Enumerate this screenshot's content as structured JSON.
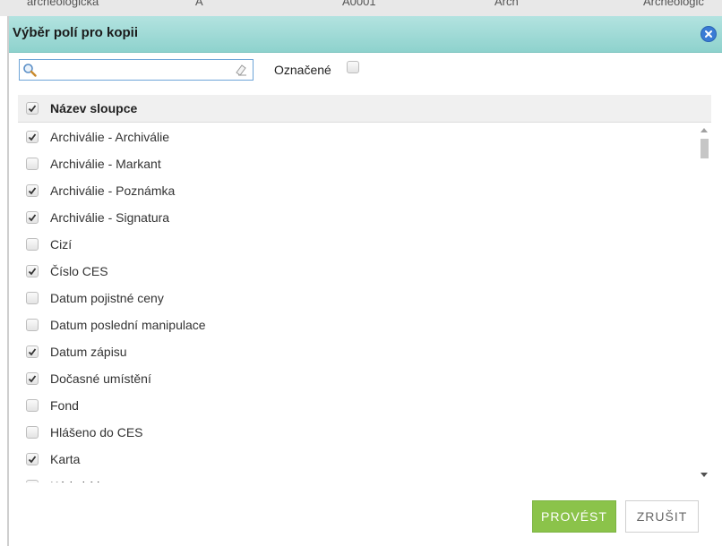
{
  "background_row": {
    "cells": [
      "archeologická",
      "A",
      "A0001",
      "Arch",
      "Archeologic"
    ]
  },
  "dialog": {
    "title": "Výběr polí pro kopii",
    "search": {
      "value": "",
      "placeholder": ""
    },
    "marked_label": "Označené",
    "marked_checked": false,
    "header": {
      "label": "Název sloupce",
      "checked": true
    },
    "items": [
      {
        "label": "Archiválie - Archiválie",
        "checked": true
      },
      {
        "label": "Archiválie - Markant",
        "checked": false
      },
      {
        "label": "Archiválie - Poznámka",
        "checked": true
      },
      {
        "label": "Archiválie - Signatura",
        "checked": true
      },
      {
        "label": "Cizí",
        "checked": false
      },
      {
        "label": "Číslo CES",
        "checked": true
      },
      {
        "label": "Datum pojistné ceny",
        "checked": false
      },
      {
        "label": "Datum poslední manipulace",
        "checked": false
      },
      {
        "label": "Datum zápisu",
        "checked": true
      },
      {
        "label": "Dočasné umístění",
        "checked": true
      },
      {
        "label": "Fond",
        "checked": false
      },
      {
        "label": "Hlášeno do CES",
        "checked": false
      },
      {
        "label": "Karta",
        "checked": true
      },
      {
        "label": "Kód sbírky",
        "checked": true
      }
    ],
    "buttons": {
      "ok": "PROVÉST",
      "cancel": "ZRUŠIT"
    }
  },
  "colors": {
    "titlebar": "#9fdbd6",
    "ok_button": "#8bc34a",
    "close_button": "#3a7bd5"
  },
  "icons": {
    "close": "close-icon",
    "search": "search-icon",
    "eraser": "eraser-icon",
    "check": "checkmark-icon"
  }
}
